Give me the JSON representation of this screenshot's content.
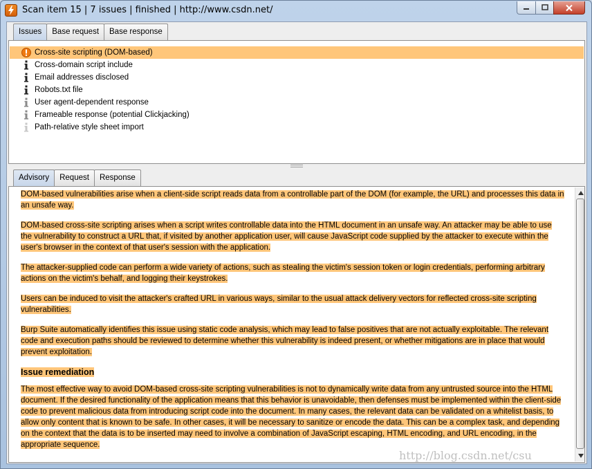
{
  "window": {
    "title": "Scan item 15 | 7 issues | finished | http://www.csdn.net/",
    "icon": "burp-lightning-icon"
  },
  "top_tabs": [
    {
      "label": "Issues",
      "active": true
    },
    {
      "label": "Base request",
      "active": false
    },
    {
      "label": "Base response",
      "active": false
    }
  ],
  "issues": [
    {
      "label": "Cross-site scripting (DOM-based)",
      "severity": "high",
      "icon": "warning-icon",
      "selected": true
    },
    {
      "label": "Cross-domain script include",
      "severity": "info",
      "icon": "info-icon",
      "selected": false
    },
    {
      "label": "Email addresses disclosed",
      "severity": "info",
      "icon": "info-icon",
      "selected": false
    },
    {
      "label": "Robots.txt file",
      "severity": "info",
      "icon": "info-icon",
      "selected": false
    },
    {
      "label": "User agent-dependent response",
      "severity": "info-tentative",
      "icon": "info-icon",
      "selected": false
    },
    {
      "label": "Frameable response (potential Clickjacking)",
      "severity": "info-tentative",
      "icon": "info-icon",
      "selected": false
    },
    {
      "label": "Path-relative style sheet import",
      "severity": "info-faint",
      "icon": "info-icon",
      "selected": false
    }
  ],
  "bottom_tabs": [
    {
      "label": "Advisory",
      "active": true
    },
    {
      "label": "Request",
      "active": false
    },
    {
      "label": "Response",
      "active": false
    }
  ],
  "advisory": {
    "paragraphs": [
      "DOM-based vulnerabilities arise when a client-side script reads data from a controllable part of the DOM (for example, the URL) and processes this data in an unsafe way.",
      "DOM-based cross-site scripting arises when a script writes controllable data into the HTML document in an unsafe way. An attacker may be able to use the vulnerability to construct a URL that, if visited by another application user, will cause JavaScript code supplied by the attacker to execute within the user's browser in the context of that user's session with the application.",
      "The attacker-supplied code can perform a wide variety of actions, such as stealing the victim's session token or login credentials, performing arbitrary actions on the victim's behalf, and logging their keystrokes.",
      "Users can be induced to visit the attacker's crafted URL in various ways, similar to the usual attack delivery vectors for reflected cross-site scripting vulnerabilities.",
      "Burp Suite automatically identifies this issue using static code analysis, which may lead to false positives that are not actually exploitable. The relevant code and execution paths should be reviewed to determine whether this vulnerability is indeed present, or whether mitigations are in place that would prevent exploitation."
    ],
    "remediation_heading": "Issue remediation",
    "remediation_text": "The most effective way to avoid DOM-based cross-site scripting vulnerabilities is not to dynamically write data from any untrusted source into the HTML document. If the desired functionality of the application means that this behavior is unavoidable, then defenses must be implemented within the client-side code to prevent malicious data from introducing script code into the document. In many cases, the relevant data can be validated on a whitelist basis, to allow only content that is known to be safe. In other cases, it will be necessary to sanitize or encode the data. This can be a complex task, and depending on the context that the data is to be inserted may need to involve a combination of JavaScript escaping, HTML encoding, and URL encoding, in the appropriate sequence."
  },
  "watermark": "http://blog.csdn.net/csu",
  "colors": {
    "highlight": "#ffc67a",
    "high_severity": "#f07a10",
    "info": "#222222",
    "info_tentative": "#8a8a8a",
    "info_faint": "#c8c8c8"
  }
}
